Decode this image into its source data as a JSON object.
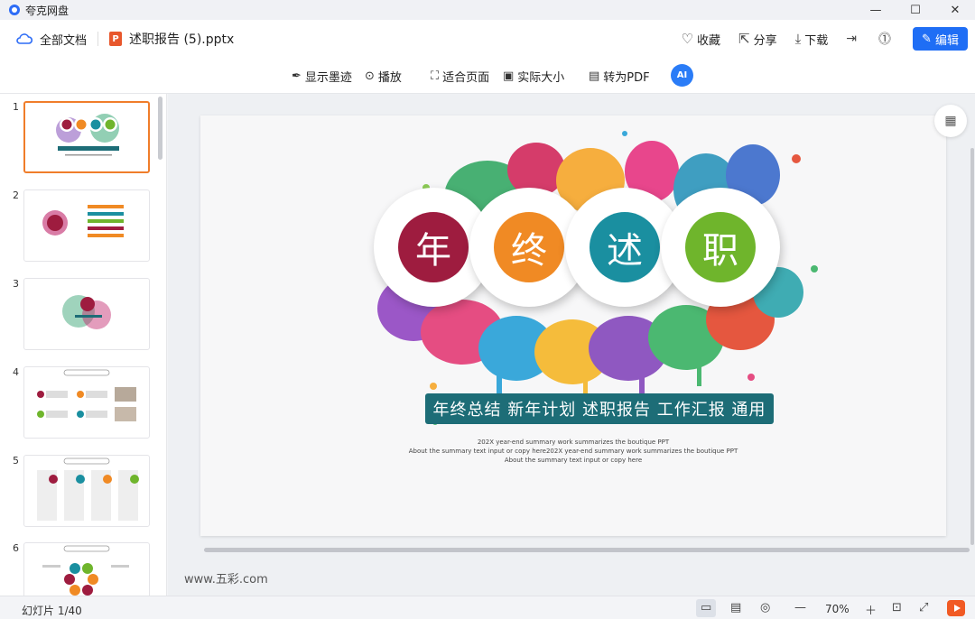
{
  "app": {
    "title": "夸克网盘"
  },
  "window": {
    "minimize": "—",
    "maximize": "☐",
    "close": "✕"
  },
  "toolbar": {
    "all_docs": "全部文档",
    "file_icon": "P",
    "file_name": "述职报告 (5).pptx",
    "favorite": "收藏",
    "share": "分享",
    "download": "下载",
    "edit": "编辑"
  },
  "toolbar2": {
    "show_ink": "显示墨迹",
    "play": "播放",
    "fit_page": "适合页面",
    "actual_size": "实际大小",
    "to_pdf": "转为PDF",
    "ai": "AI"
  },
  "thumbnails": [
    {
      "num": "1"
    },
    {
      "num": "2"
    },
    {
      "num": "3"
    },
    {
      "num": "4"
    },
    {
      "num": "5"
    },
    {
      "num": "6"
    }
  ],
  "slide": {
    "chars": [
      "年",
      "终",
      "述",
      "职"
    ],
    "colors": [
      "#9e1c3f",
      "#f08a24",
      "#1a8fa0",
      "#6fb52c"
    ],
    "banner": "年终总结  新年计划 述职报告  工作汇报  通用",
    "sub1": "202X year-end summary work summarizes the boutique PPT",
    "sub2": "About the summary text input or copy here202X year-end summary work summarizes the boutique PPT",
    "sub3": "About the summary text input or copy here"
  },
  "watermark": "www.五彩.com",
  "status": {
    "slide_count": "幻灯片 1/40",
    "zoom": "70%"
  }
}
